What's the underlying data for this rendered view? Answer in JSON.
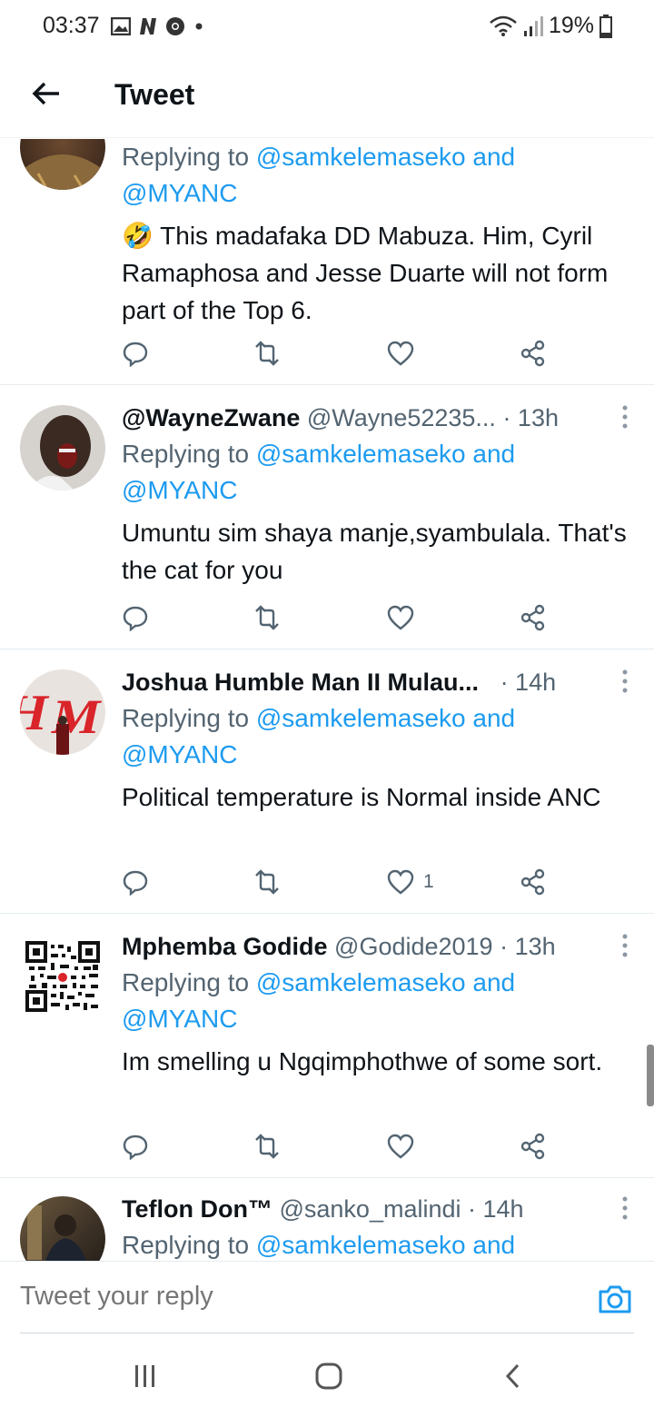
{
  "status_bar": {
    "time": "03:37",
    "battery": "19%"
  },
  "header": {
    "title": "Tweet"
  },
  "tweets": [
    {
      "reply_prefix": "Replying to",
      "reply_mention": "@samkelemaseko and",
      "reply_mention2": "@MYANC",
      "text": "🤣 This madafaka DD Mabuza. Him, Cyril Ramaphosa and Jesse Duarte will not form part of the Top 6.",
      "likes": ""
    },
    {
      "name": "@WayneZwane",
      "handle": "@Wayne52235...",
      "time": "· 13h",
      "reply_prefix": "Replying to",
      "reply_mention": "@samkelemaseko and",
      "reply_mention2": "@MYANC",
      "text": "Umuntu  sim shaya manje,syambulala. That's  the  cat for you",
      "likes": ""
    },
    {
      "name": "Joshua Humble Man II Mulau...",
      "handle": "",
      "time": "· 14h",
      "reply_prefix": "Replying to",
      "reply_mention": "@samkelemaseko and",
      "reply_mention2": "@MYANC",
      "text": "Political temperature is Normal inside ANC",
      "likes": "1"
    },
    {
      "name": "Mphemba Godide",
      "handle": "@Godide2019",
      "time": "· 13h",
      "reply_prefix": "Replying to",
      "reply_mention": "@samkelemaseko and",
      "reply_mention2": "@MYANC",
      "text": "Im smelling u Ngqimphothwe of some sort.",
      "likes": ""
    },
    {
      "name": "Teflon Don™",
      "handle": "@sanko_malindi",
      "time": "· 14h",
      "reply_prefix": "Replying to",
      "reply_mention": "@samkelemaseko and"
    }
  ],
  "reply_bar": {
    "placeholder": "Tweet your reply"
  },
  "icons": {
    "back": "arrow-left-icon",
    "reply": "reply-icon",
    "retweet": "retweet-icon",
    "like": "heart-icon",
    "share": "share-icon",
    "camera": "camera-icon",
    "more": "more-vertical-icon"
  },
  "colors": {
    "link": "#1d9bf0",
    "secondary": "#536471",
    "text": "#0f1419"
  }
}
